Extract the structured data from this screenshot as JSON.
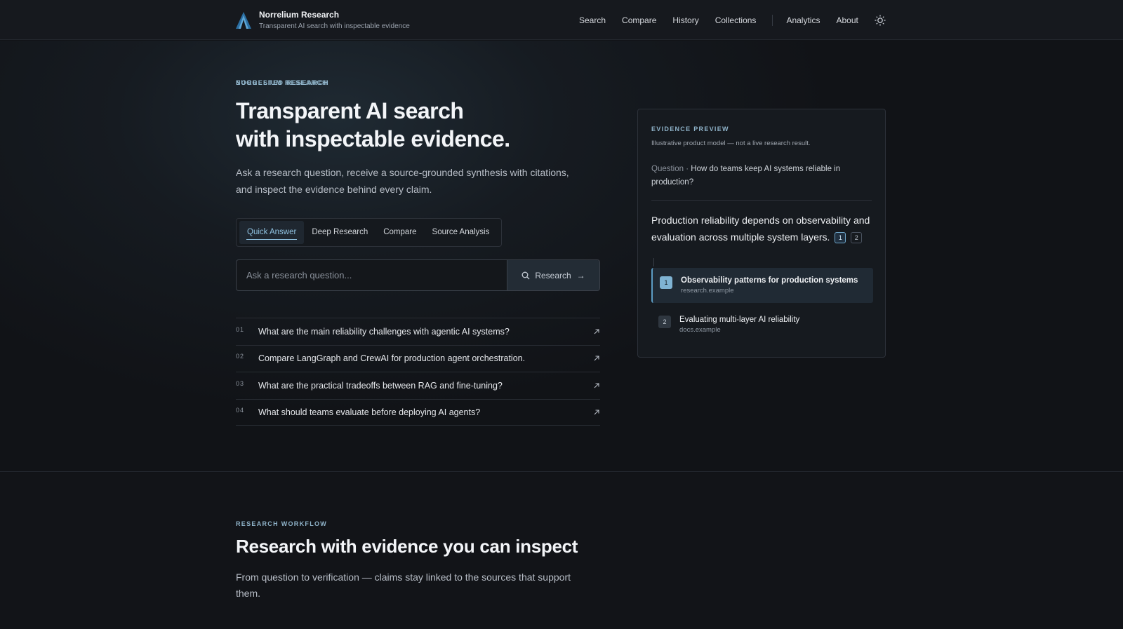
{
  "header": {
    "brand_name": "Norrelium Research",
    "brand_tagline": "Transparent AI search with inspectable evidence",
    "nav": [
      "Search",
      "Compare",
      "History",
      "Collections",
      "Analytics",
      "About"
    ]
  },
  "hero": {
    "eyebrow": "NORRELIUM RESEARCH",
    "title_line1": "Transparent AI search",
    "title_line2": "with inspectable evidence.",
    "subtitle": "Ask a research question, receive a source-grounded synthesis with citations, and inspect the evidence behind every claim.",
    "tabs": [
      "Quick Answer",
      "Deep Research",
      "Compare",
      "Source Analysis"
    ],
    "active_tab": "Quick Answer",
    "search_placeholder": "Ask a research question...",
    "search_button": "Research",
    "suggested_label": "SUGGESTED RESEARCH",
    "suggestions": [
      {
        "num": "01",
        "text": "What are the main reliability challenges with agentic AI systems?"
      },
      {
        "num": "02",
        "text": "Compare LangGraph and CrewAI for production agent orchestration."
      },
      {
        "num": "03",
        "text": "What are the practical tradeoffs between RAG and fine-tuning?"
      },
      {
        "num": "04",
        "text": "What should teams evaluate before deploying AI agents?"
      }
    ]
  },
  "evidence": {
    "eyebrow": "EVIDENCE PREVIEW",
    "note": "Illustrative product model — not a live research result.",
    "question_label": "Question ·",
    "question": "How do teams keep AI systems reliable in production?",
    "claim": "Production reliability depends on observability and evaluation across multiple system layers.",
    "citations": [
      "1",
      "2"
    ],
    "sources": [
      {
        "num": "1",
        "title": "Observability patterns for production systems",
        "domain": "research.example"
      },
      {
        "num": "2",
        "title": "Evaluating multi-layer AI reliability",
        "domain": "docs.example"
      }
    ]
  },
  "workflow": {
    "eyebrow": "RESEARCH WORKFLOW",
    "title": "Research with evidence you can inspect",
    "subtitle": "From question to verification — claims stay linked to the sources that support them."
  },
  "colors": {
    "background": "#111317",
    "accent": "#8fc0de",
    "active_source": "#7fb3d3"
  }
}
